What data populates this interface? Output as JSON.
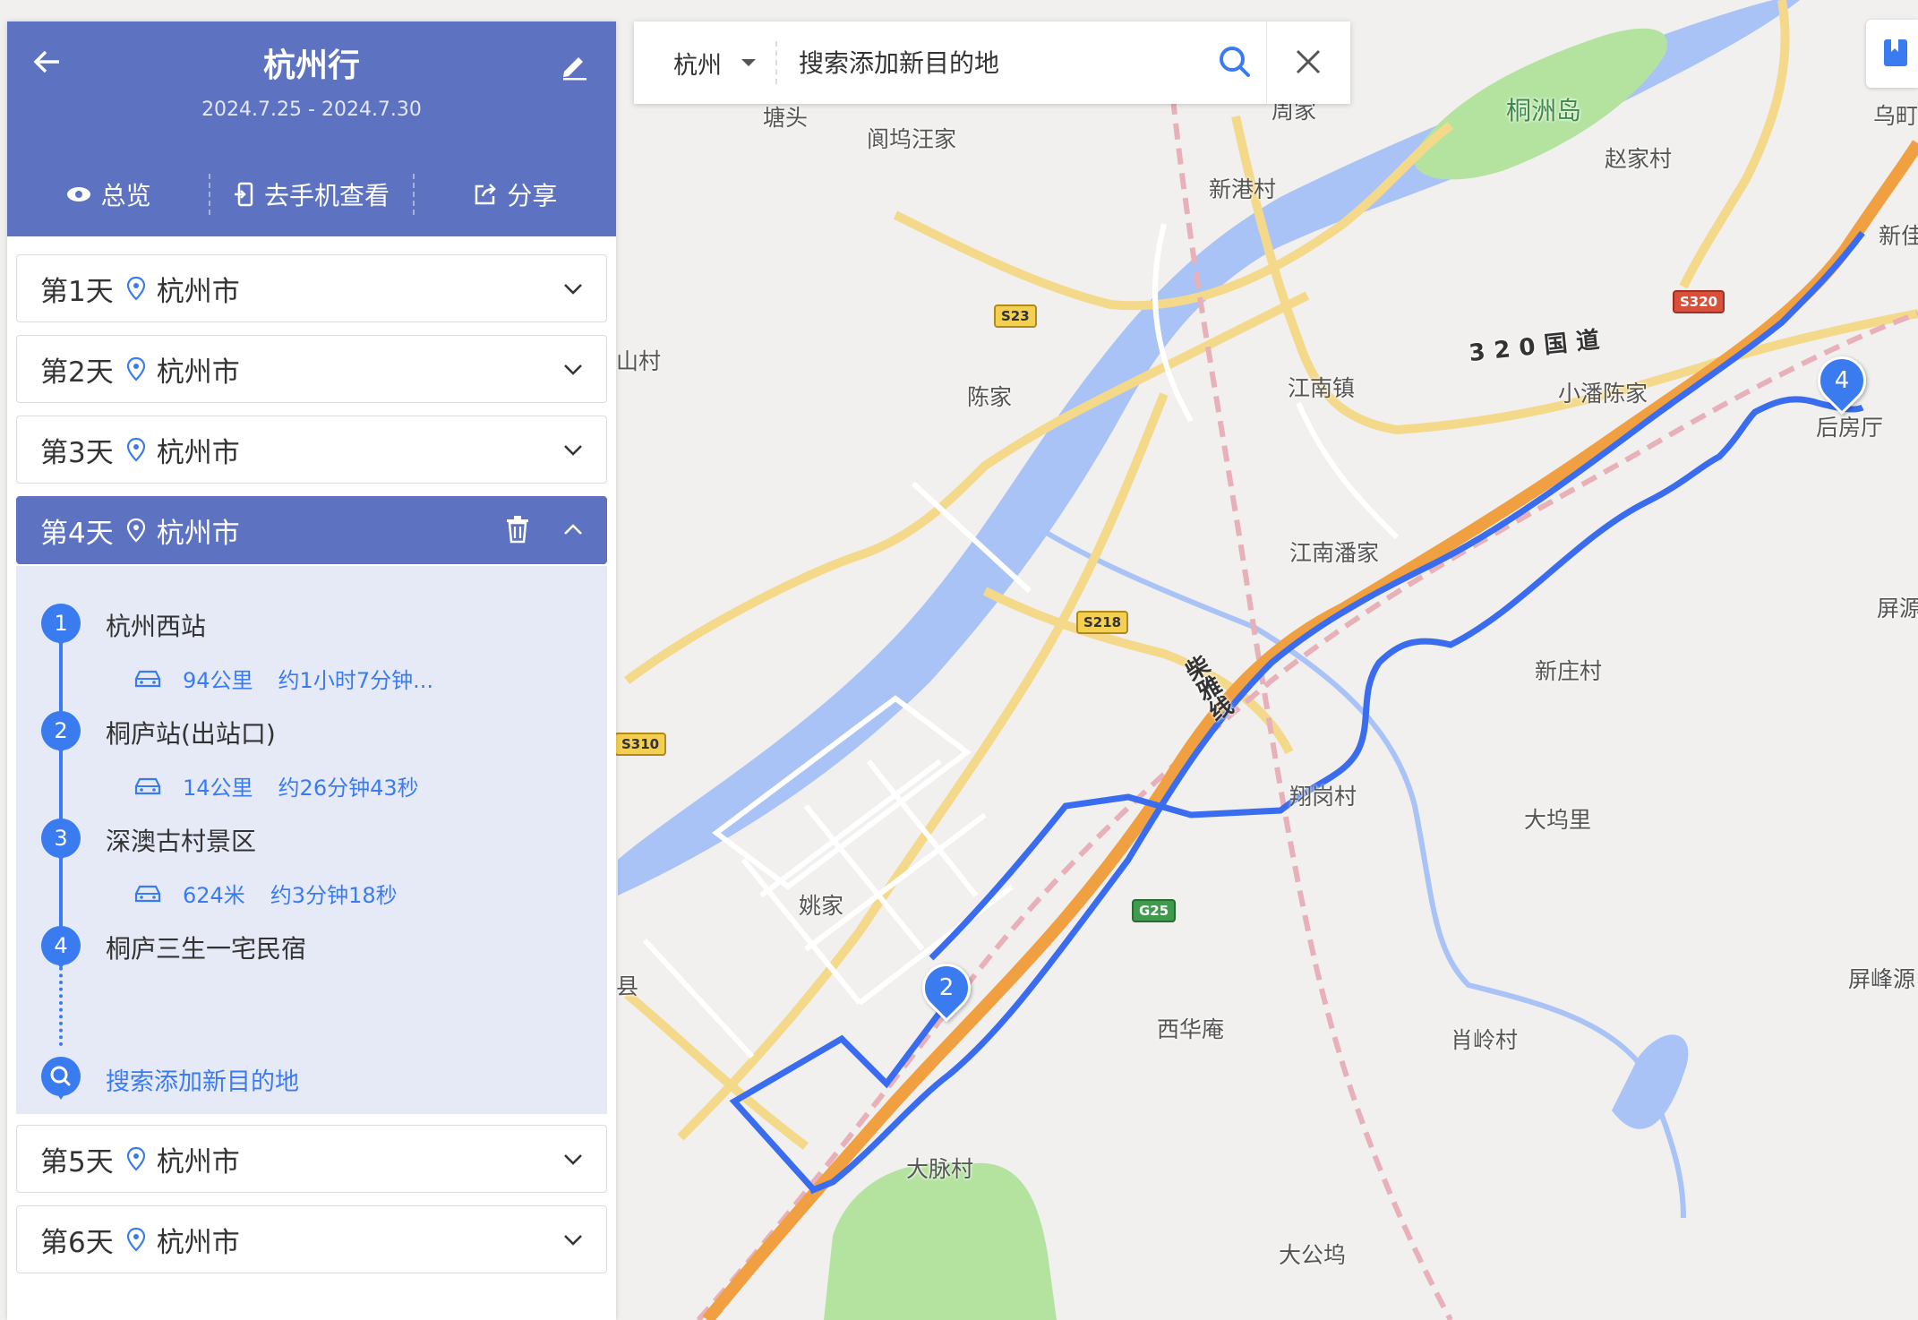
{
  "app": {
    "brand_color": "#5d72c0",
    "accent_color": "#3a7cf0",
    "route_color": "#3a6cf0",
    "highway_color": "#f0a040"
  },
  "trip": {
    "title": "杭州行",
    "dates": "2024.7.25 - 2024.7.30",
    "actions": [
      {
        "label": "总览",
        "icon": "eye-icon"
      },
      {
        "label": "去手机查看",
        "icon": "phone-export-icon"
      },
      {
        "label": "分享",
        "icon": "share-icon"
      }
    ]
  },
  "days": [
    {
      "label": "第1天",
      "city": "杭州市",
      "expanded": false
    },
    {
      "label": "第2天",
      "city": "杭州市",
      "expanded": false
    },
    {
      "label": "第3天",
      "city": "杭州市",
      "expanded": false
    },
    {
      "label": "第4天",
      "city": "杭州市",
      "expanded": true
    },
    {
      "label": "第5天",
      "city": "杭州市",
      "expanded": false
    },
    {
      "label": "第6天",
      "city": "杭州市",
      "expanded": false
    }
  ],
  "day4": {
    "stops": [
      {
        "num": "1",
        "name": "杭州西站",
        "distance": "94公里",
        "duration": "约1小时7分钟..."
      },
      {
        "num": "2",
        "name": "桐庐站(出站口)",
        "distance": "14公里",
        "duration": "约26分钟43秒"
      },
      {
        "num": "3",
        "name": "深澳古村景区",
        "distance": "624米",
        "duration": "约3分钟18秒"
      },
      {
        "num": "4",
        "name": "桐庐三生一宅民宿"
      }
    ],
    "search_add_label": "搜索添加新目的地"
  },
  "search": {
    "city": "杭州",
    "placeholder": "搜索添加新目的地"
  },
  "map": {
    "markers": [
      "2",
      "4"
    ],
    "place_labels": {
      "tangtou": "塘头",
      "kewuwangjia": "阆坞汪家",
      "tongzhoudao": "桐洲岛",
      "zhaojiacun": "赵家村",
      "xingangcun": "新港村",
      "zhoujia": "周家",
      "shancun": "山村",
      "chenjia": "陈家",
      "jiangnanzhen": "江南镇",
      "xiaopanchenjia": "小潘陈家",
      "houfangting": "后房厅",
      "jiangnanpanjia": "江南潘家",
      "xinzhuangcun": "新庄村",
      "xianggangcun": "翔岗村",
      "dawuli": "大坞里",
      "yaojia": "姚家",
      "xian": "县",
      "xihuaan": "西华庵",
      "xiaolingcun": "肖岭村",
      "pingfengyuan": "屏峰源",
      "pingyuan": "屏源",
      "damaicun": "大脉村",
      "dagongwu": "大公坞",
      "xinjia": "新佳",
      "wuci": "乌町"
    },
    "road_labels": {
      "guodao": "320国道",
      "chaiya": "柴雅线",
      "s23": "S23",
      "s218": "S218",
      "s3320": "S320",
      "s310": "S310",
      "g25": "G25"
    }
  }
}
